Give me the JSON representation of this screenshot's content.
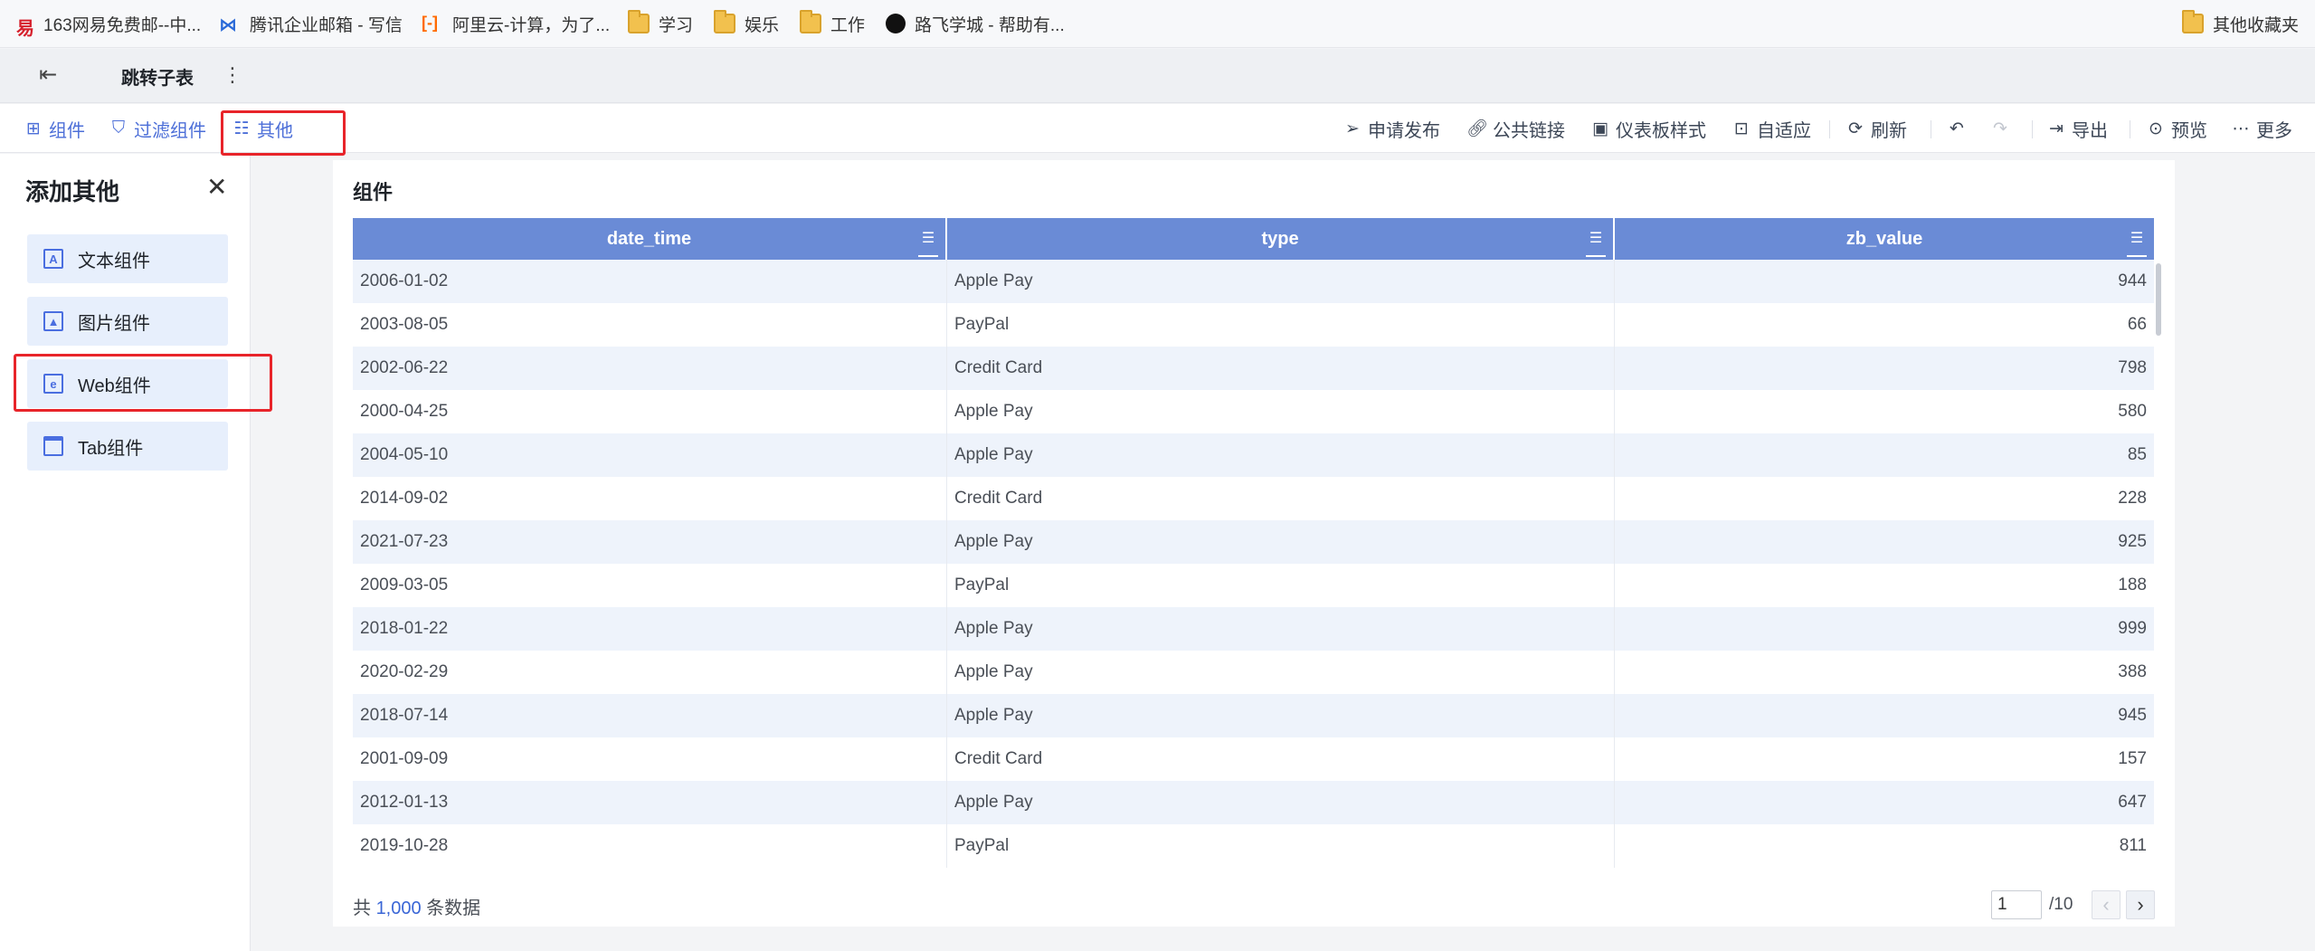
{
  "bookmarks": [
    {
      "label": "163网易免费邮--中...",
      "icon": "netease-icon"
    },
    {
      "label": "腾讯企业邮箱 - 写信",
      "icon": "tencent-mail-icon"
    },
    {
      "label": "阿里云-计算，为了...",
      "icon": "aliyun-icon"
    },
    {
      "label": "学习",
      "icon": "folder-icon"
    },
    {
      "label": "娱乐",
      "icon": "folder-icon"
    },
    {
      "label": "工作",
      "icon": "folder-icon"
    },
    {
      "label": "路飞学城 - 帮助有...",
      "icon": "luffy-icon"
    }
  ],
  "bookmarks_other": "其他收藏夹",
  "tabstrip": {
    "active_tab": "跳转子表"
  },
  "toolbar": {
    "left": [
      {
        "label": "组件",
        "icon": "component-icon"
      },
      {
        "label": "过滤组件",
        "icon": "filter-component-icon"
      },
      {
        "label": "其他",
        "icon": "other-icon"
      }
    ],
    "right": [
      {
        "label": "申请发布",
        "icon": "send-icon"
      },
      {
        "label": "公共链接",
        "icon": "link-icon"
      },
      {
        "label": "仪表板样式",
        "icon": "dashboard-style-icon"
      },
      {
        "label": "自适应",
        "icon": "adaptive-icon"
      },
      {
        "label": "刷新",
        "icon": "refresh-icon"
      },
      {
        "label": "导出",
        "icon": "export-icon"
      },
      {
        "label": "预览",
        "icon": "preview-icon"
      },
      {
        "label": "更多",
        "icon": "more-icon"
      }
    ]
  },
  "side_panel": {
    "title": "添加其他",
    "items": [
      {
        "label": "文本组件",
        "icon": "text-component-icon"
      },
      {
        "label": "图片组件",
        "icon": "image-component-icon"
      },
      {
        "label": "Web组件",
        "icon": "web-component-icon"
      },
      {
        "label": "Tab组件",
        "icon": "tab-component-icon"
      }
    ]
  },
  "widget": {
    "title": "组件",
    "columns": [
      "date_time",
      "type",
      "zb_value"
    ],
    "rows": [
      [
        "2006-01-02",
        "Apple Pay",
        "944"
      ],
      [
        "2003-08-05",
        "PayPal",
        "66"
      ],
      [
        "2002-06-22",
        "Credit Card",
        "798"
      ],
      [
        "2000-04-25",
        "Apple Pay",
        "580"
      ],
      [
        "2004-05-10",
        "Apple Pay",
        "85"
      ],
      [
        "2014-09-02",
        "Credit Card",
        "228"
      ],
      [
        "2021-07-23",
        "Apple Pay",
        "925"
      ],
      [
        "2009-03-05",
        "PayPal",
        "188"
      ],
      [
        "2018-01-22",
        "Apple Pay",
        "999"
      ],
      [
        "2020-02-29",
        "Apple Pay",
        "388"
      ],
      [
        "2018-07-14",
        "Apple Pay",
        "945"
      ],
      [
        "2001-09-09",
        "Credit Card",
        "157"
      ],
      [
        "2012-01-13",
        "Apple Pay",
        "647"
      ],
      [
        "2019-10-28",
        "PayPal",
        "811"
      ]
    ],
    "footer": {
      "prefix": "共",
      "total": "1,000",
      "suffix": "条数据"
    },
    "pagination": {
      "current": "1",
      "total": "/10"
    }
  },
  "colors": {
    "header_bg": "#6a8bd6",
    "highlight": "#e8242a",
    "accent": "#4d6fd8"
  }
}
